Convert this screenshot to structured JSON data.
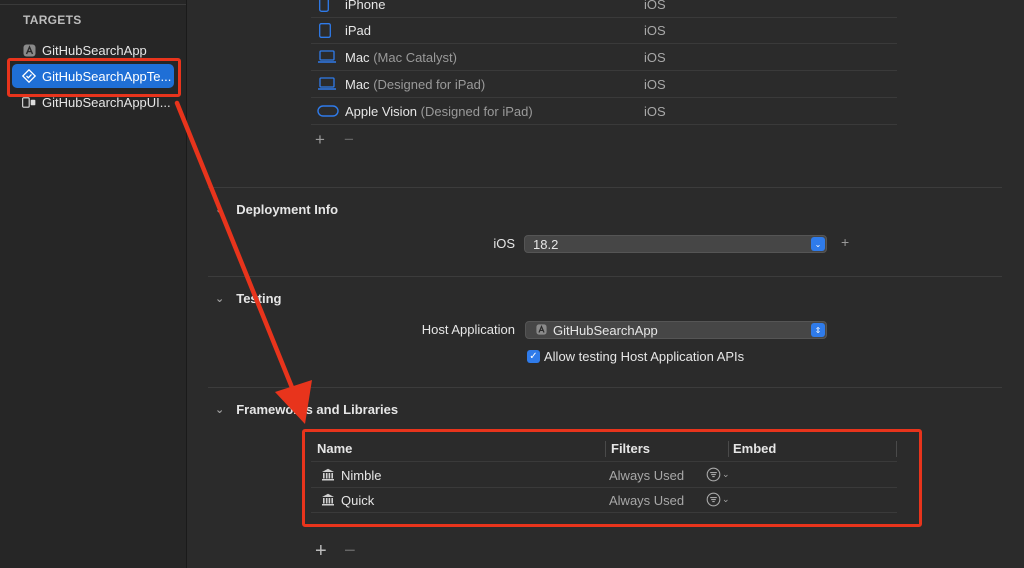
{
  "sidebar": {
    "heading": "TARGETS",
    "items": [
      {
        "label": "GitHubSearchApp",
        "icon": "app-target-icon",
        "selected": false
      },
      {
        "label": "GitHubSearchAppTe...",
        "icon": "unit-test-bundle-icon",
        "selected": true
      },
      {
        "label": "GitHubSearchAppUI...",
        "icon": "ui-test-bundle-icon",
        "selected": false
      }
    ]
  },
  "destinations": {
    "rows": [
      {
        "name": "iPhone",
        "detail": "",
        "sdk": "iOS",
        "icon": "iphone-icon"
      },
      {
        "name": "iPad",
        "detail": "",
        "sdk": "iOS",
        "icon": "ipad-icon"
      },
      {
        "name": "Mac",
        "detail": "(Mac Catalyst)",
        "sdk": "iOS",
        "icon": "mac-icon"
      },
      {
        "name": "Mac",
        "detail": "(Designed for iPad)",
        "sdk": "iOS",
        "icon": "mac-icon"
      },
      {
        "name": "Apple Vision",
        "detail": "(Designed for iPad)",
        "sdk": "iOS",
        "icon": "vision-pro-icon"
      }
    ],
    "add_label": "+",
    "remove_label": "−"
  },
  "deployment": {
    "title": "Deployment Info",
    "ios_label": "iOS",
    "ios_version": "18.2",
    "add_label": "+"
  },
  "testing": {
    "title": "Testing",
    "host_label": "Host Application",
    "host_value": "GitHubSearchApp",
    "allow_label": "Allow testing Host Application APIs",
    "allow_checked": true
  },
  "frameworks": {
    "title": "Frameworks and Libraries",
    "columns": [
      "Name",
      "Filters",
      "Embed"
    ],
    "rows": [
      {
        "name": "Nimble",
        "filter": "Always Used"
      },
      {
        "name": "Quick",
        "filter": "Always Used"
      }
    ],
    "add_label": "+",
    "remove_label": "−"
  },
  "colors": {
    "accent": "#2f7bea",
    "selection": "#1f6fd6",
    "annotation_red": "#e8341c"
  }
}
